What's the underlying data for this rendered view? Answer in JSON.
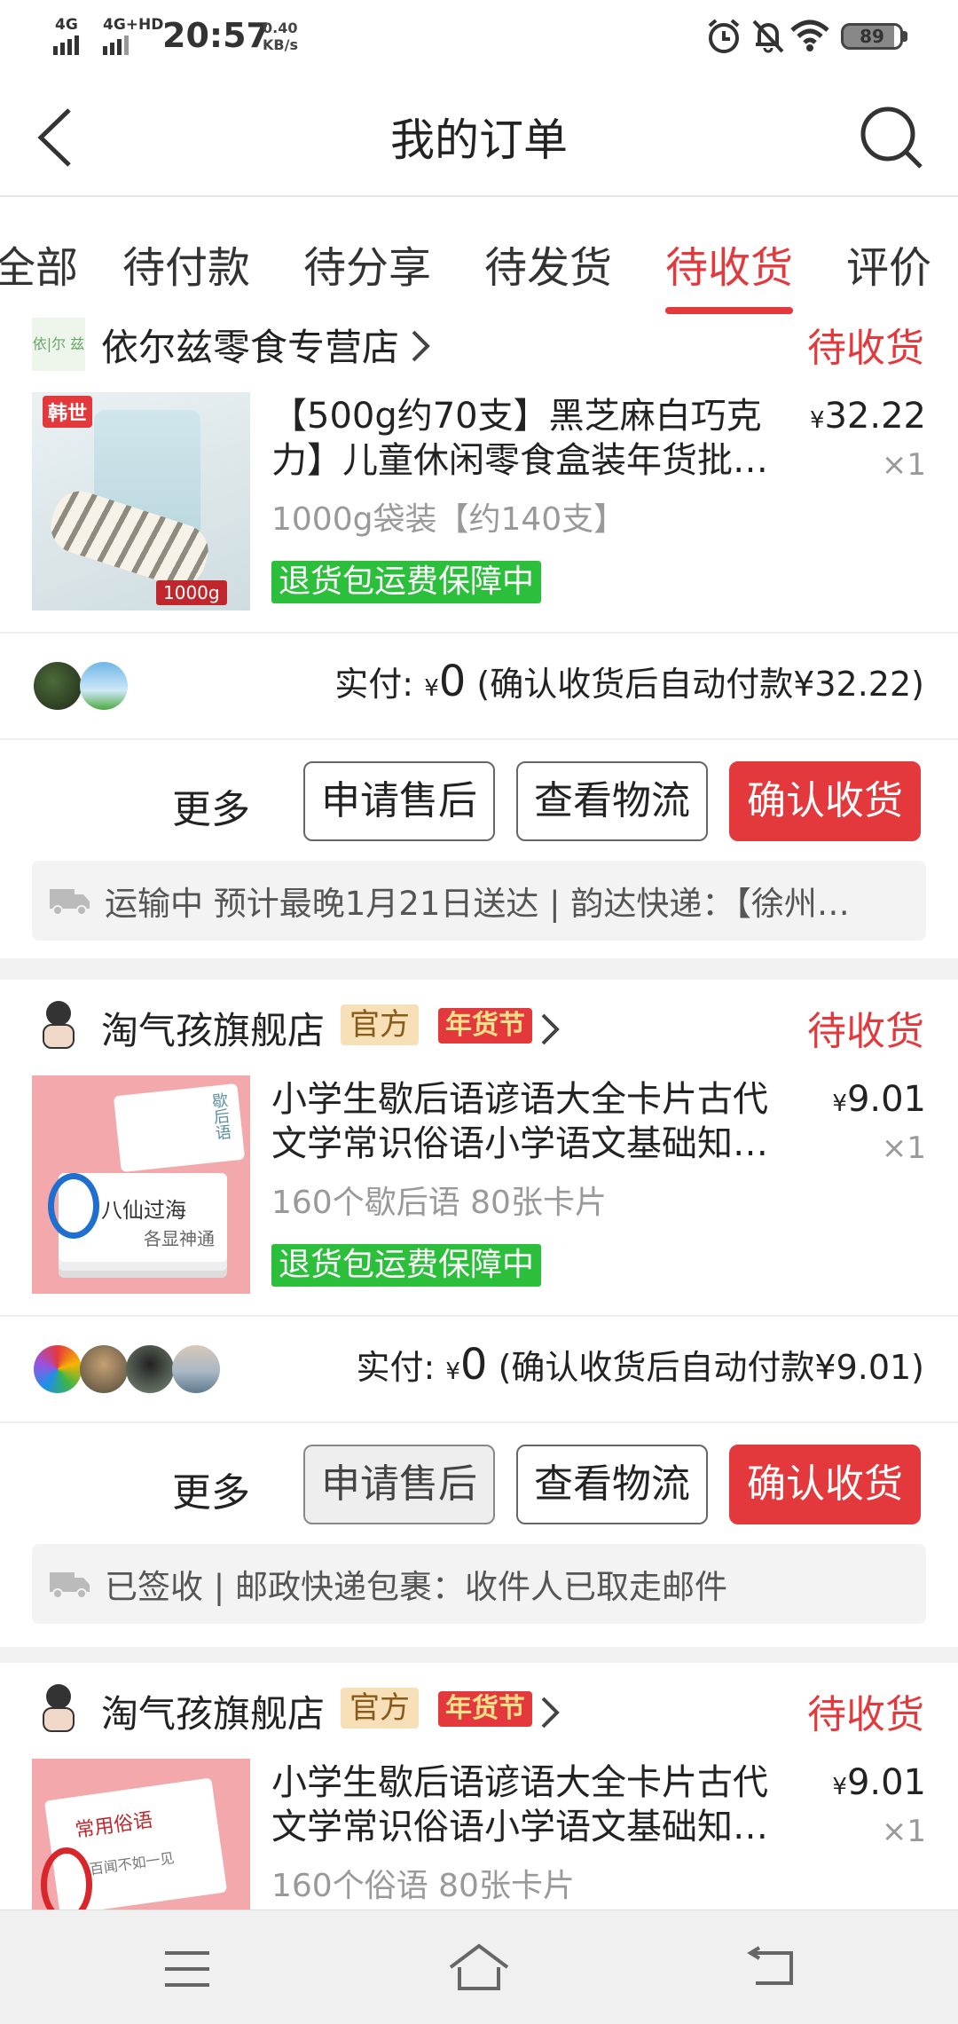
{
  "status_bar": {
    "sig1": "4G",
    "sig2": "4G+HD",
    "time": "20:57",
    "speed_value": "0.40",
    "speed_unit": "KB/s",
    "battery": "89"
  },
  "header": {
    "title": "我的订单"
  },
  "tabs": [
    {
      "label": "全部"
    },
    {
      "label": "待付款"
    },
    {
      "label": "待分享"
    },
    {
      "label": "待发货"
    },
    {
      "label": "待收货"
    },
    {
      "label": "评价"
    }
  ],
  "orders": [
    {
      "store_logo_text": "依|尔 兹",
      "store_name": "依尔兹零食专营店",
      "status": "待收货",
      "product_badge": "韩世",
      "product_weight_tag": "1000g",
      "product_title": "【500g约70支】黑芝麻白巧克力】儿童休闲零食盒装年货批…",
      "variant": "1000g袋装【约140支】",
      "guarantee": "退货包运费保障中",
      "price_symbol": "¥",
      "price": "32.22",
      "qty": "×1",
      "paid_label": "实付:",
      "paid_symbol": "¥",
      "paid_amount": "0",
      "paid_note": "(确认收货后自动付款¥32.22)",
      "more_label": "更多",
      "btn_aftersale": "申请售后",
      "btn_logistics": "查看物流",
      "btn_confirm": "确认收货",
      "logistics_text": "运输中 预计最晚1月21日送达 | 韵达快递：【徐州…"
    },
    {
      "store_name": "淘气孩旗舰店",
      "tag_official": "官方",
      "tag_festival": "年货节",
      "status": "待收货",
      "product_img_text_1": "歇后语",
      "product_img_text_2": "八仙过海",
      "product_img_text_3": "各显神通",
      "product_title": "小学生歇后语谚语大全卡片古代文学常识俗语小学语文基础知…",
      "variant": "160个歇后语 80张卡片",
      "guarantee": "退货包运费保障中",
      "price_symbol": "¥",
      "price": "9.01",
      "qty": "×1",
      "paid_label": "实付:",
      "paid_symbol": "¥",
      "paid_amount": "0",
      "paid_note": "(确认收货后自动付款¥9.01)",
      "more_label": "更多",
      "btn_aftersale": "申请售后",
      "btn_logistics": "查看物流",
      "btn_confirm": "确认收货",
      "logistics_text": "已签收 | 邮政快递包裹：收件人已取走邮件"
    },
    {
      "store_name": "淘气孩旗舰店",
      "tag_official": "官方",
      "tag_festival": "年货节",
      "status": "待收货",
      "product_img_text_1": "常用俗语",
      "product_img_text_2": "百闻不如一见",
      "product_title": "小学生歇后语谚语大全卡片古代文学常识俗语小学语文基础知…",
      "variant": "160个俗语 80张卡片",
      "price_symbol": "¥",
      "price": "9.01",
      "qty": "×1"
    }
  ],
  "colors": {
    "accent": "#e4393c",
    "guarantee_green": "#2cbf3b"
  }
}
